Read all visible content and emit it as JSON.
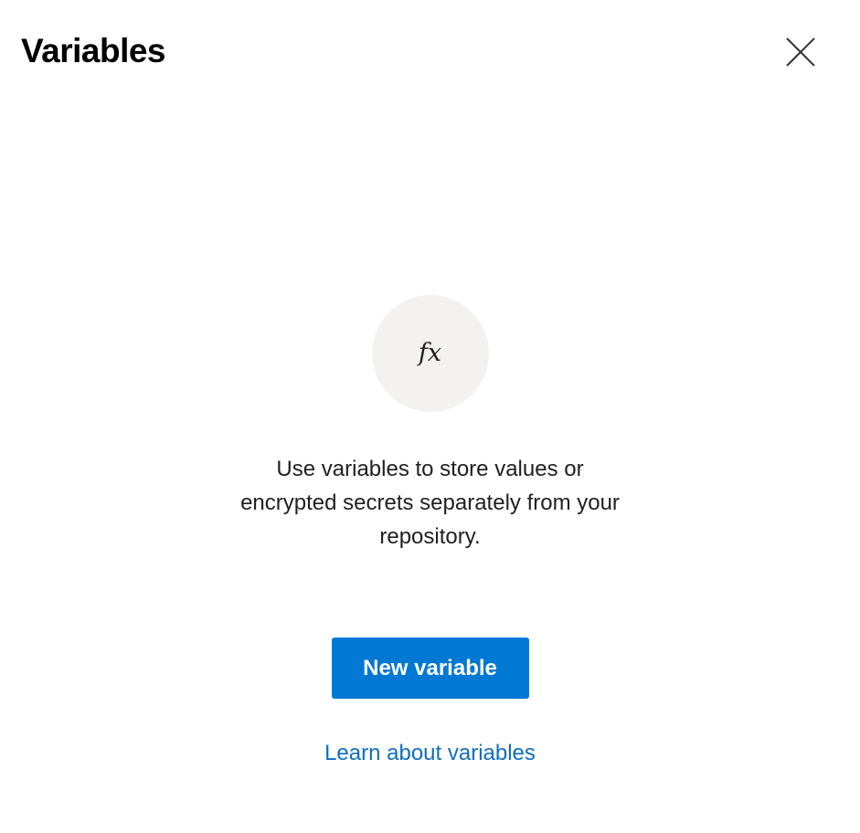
{
  "panel": {
    "title": "Variables",
    "close_label": "Close"
  },
  "empty_state": {
    "icon_text": "fx",
    "message": "Use variables to store values or encrypted secrets separately from your repository.",
    "primary_button_label": "New variable",
    "link_label": "Learn about variables"
  },
  "colors": {
    "primary": "#0078d4",
    "link": "#106ebe",
    "icon_circle": "#f3f2f1"
  }
}
